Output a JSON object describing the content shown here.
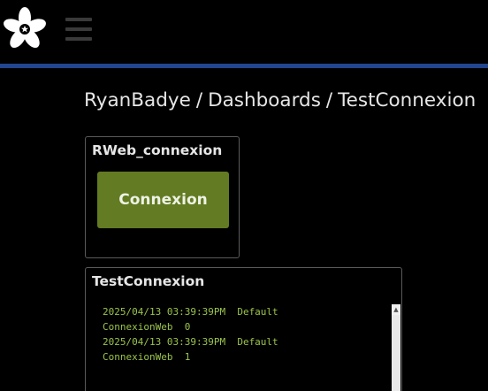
{
  "colors": {
    "background": "#000000",
    "accent_bar": "#21468f",
    "button_bg": "#637b22",
    "stream_text": "#9bc44a",
    "border": "#5a5a5a"
  },
  "header": {
    "logo_icon": "adafruit-flower-logo",
    "menu_icon": "hamburger-menu-icon"
  },
  "breadcrumb": {
    "user": "RyanBadye",
    "separator": "/",
    "section": "Dashboards",
    "page": "TestConnexion"
  },
  "blocks": [
    {
      "title": "RWeb_connexion",
      "button_label": "Connexion"
    },
    {
      "title": "TestConnexion",
      "lines": [
        "2025/04/13 03:39:39PM  Default",
        "ConnexionWeb  0",
        "2025/04/13 03:39:39PM  Default",
        "ConnexionWeb  1"
      ],
      "scroll_up_icon": "scroll-up-arrow-icon"
    }
  ]
}
